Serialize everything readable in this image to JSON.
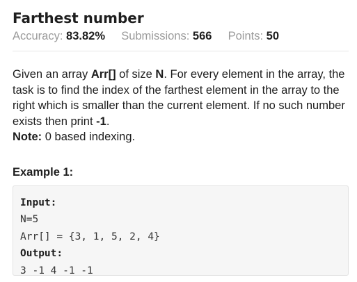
{
  "problem": {
    "title": "Farthest number",
    "stats": {
      "accuracy_label": "Accuracy:",
      "accuracy_value": "83.82%",
      "submissions_label": "Submissions:",
      "submissions_value": "566",
      "points_label": "Points:",
      "points_value": "50"
    },
    "description": {
      "p1_a": "Given an array ",
      "p1_arr": "Arr[]",
      "p1_b": " of size ",
      "p1_n": "N",
      "p1_c": ". For every element in the array, the task is to find the index of the farthest element in the array to the right which is smaller than the current element. If no such number exists then print ",
      "p1_minus1": "-1",
      "p1_d": ".",
      "note_label": "Note:",
      "note_text": " 0 based indexing."
    }
  },
  "example1": {
    "heading": "Example 1:",
    "input_label": "Input:",
    "input_line1": "N=5",
    "input_line2": "Arr[] = {3, 1, 5, 2, 4}",
    "output_label": "Output:",
    "output_line1": "3 -1 4 -1 -1"
  }
}
